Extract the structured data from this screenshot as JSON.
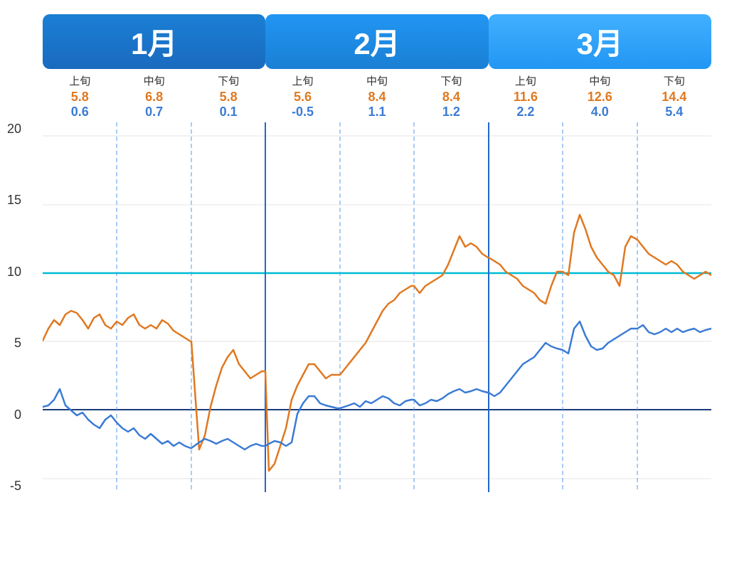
{
  "months": [
    {
      "label": "1月",
      "class": "month-jan",
      "periods": [
        {
          "label": "上旬",
          "orange": "5.8",
          "blue": "0.6"
        },
        {
          "label": "中旬",
          "orange": "6.8",
          "blue": "0.7"
        },
        {
          "label": "下旬",
          "orange": "5.8",
          "blue": "0.1"
        }
      ]
    },
    {
      "label": "2月",
      "class": "month-feb",
      "periods": [
        {
          "label": "上旬",
          "orange": "5.6",
          "blue": "-0.5"
        },
        {
          "label": "中旬",
          "orange": "8.4",
          "blue": "1.1"
        },
        {
          "label": "下旬",
          "orange": "8.4",
          "blue": "1.2"
        }
      ]
    },
    {
      "label": "3月",
      "class": "month-mar",
      "periods": [
        {
          "label": "上旬",
          "orange": "11.6",
          "blue": "2.2"
        },
        {
          "label": "中旬",
          "orange": "12.6",
          "blue": "4.0"
        },
        {
          "label": "下旬",
          "orange": "14.4",
          "blue": "5.4"
        }
      ]
    }
  ],
  "y_labels": [
    "20",
    "15",
    "10",
    "5",
    "0",
    "-5"
  ],
  "chart": {
    "y_min": -6,
    "y_max": 21,
    "orange_line": "M0,480 L12,440 L24,420 L36,430 L48,415 L60,410 L72,405 L84,420 L96,430 L108,400 L120,395 L132,415 L144,420 L156,410 L168,415 L180,400 L192,395 L204,430 L216,435 L228,440 L240,445 L252,440 L264,450 L276,455 L288,460 L300,465 L312,330 L324,310 L336,360 L348,380 L360,390 L372,380 L384,390 L396,395 L408,390 L420,385 L432,380 L444,350 L456,310 L468,295 L480,280 L492,250 L504,210 L516,195 L528,155 L540,260 L552,220 L564,210 L576,175 L588,130 L600,150 L612,155 L624,175 L636,185 L648,190 L660,195 L672,210 L684,215 L696,230 L708,245 L720,255 L732,265 L744,270 L756,280 L768,290 L780,295 L792,300 L804,305 L816,310 L828,320 L840,325 L852,330 L864,340 L876,335 L888,340 L900,345",
    "blue_line": "M0,590 L12,585 L24,570 L36,540 L48,570 L60,600 L72,610 L84,605 L96,620 L108,630 L120,635 L132,620 L144,610 L156,625 L168,635 L180,640 L192,630 L204,640 L216,645 L228,650 L240,645 L252,640 L264,650 L276,660 L288,665 L300,670 L312,660 L324,640 L336,650 L348,660 L360,655 L372,570 L384,560 L396,555 L408,565 L420,570 L432,580 L444,590 L456,580 L468,575 L480,570 L492,565 L504,555 L516,545 L528,540 L540,580 L552,570 L564,565 L576,560 L588,555 L600,560 L612,555 L624,545 L636,540 L648,535 L660,530 L672,525 L684,520 L696,490 L708,470 L720,450 L732,445 L744,460 L756,465 L768,455 L780,445 L792,440 L804,430 L816,450 L828,445 L840,460 L852,455 L864,450 L876,445 L888,455 L900,450"
  }
}
